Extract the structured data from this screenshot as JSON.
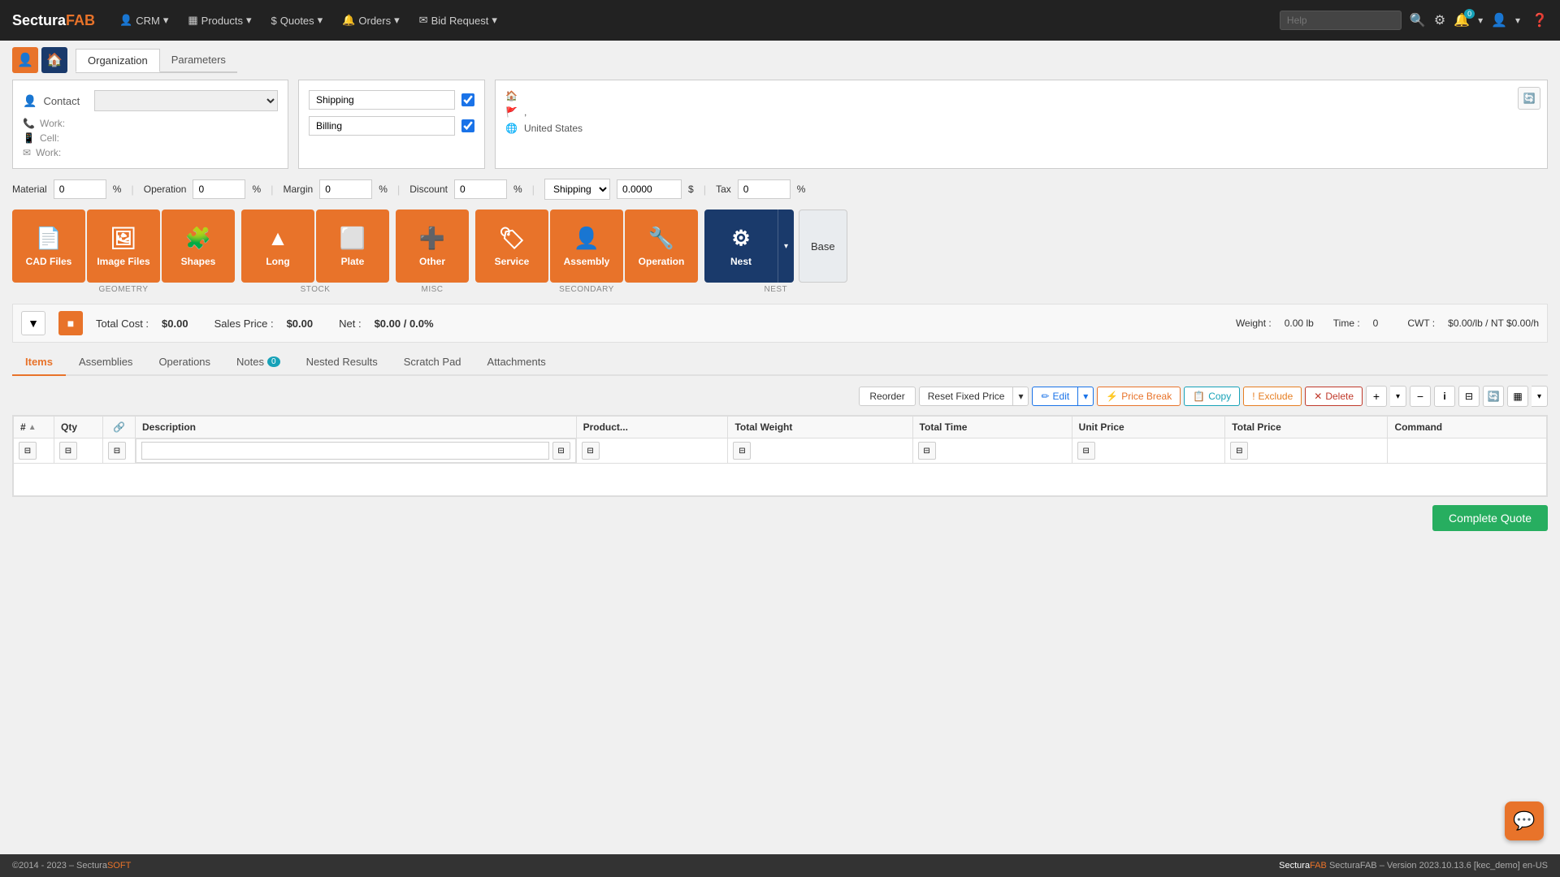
{
  "app": {
    "brand_sectura": "Sectura",
    "brand_fab": "FAB",
    "title": "SecturaFAB"
  },
  "nav": {
    "items": [
      {
        "id": "crm",
        "label": "CRM",
        "icon": "👤",
        "hasDropdown": true
      },
      {
        "id": "products",
        "label": "Products",
        "icon": "▦",
        "hasDropdown": true
      },
      {
        "id": "quotes",
        "label": "Quotes",
        "icon": "$",
        "hasDropdown": true
      },
      {
        "id": "orders",
        "label": "Orders",
        "icon": "🔔",
        "hasDropdown": true
      },
      {
        "id": "bid-request",
        "label": "Bid Request",
        "icon": "✉",
        "hasDropdown": true
      }
    ],
    "help_placeholder": "Help",
    "notifications_count": "0"
  },
  "tabs": {
    "items": [
      {
        "id": "organization",
        "label": "Organization"
      },
      {
        "id": "parameters",
        "label": "Parameters"
      }
    ]
  },
  "contact": {
    "label": "Contact",
    "work_label": "Work:",
    "cell_label": "Cell:",
    "email_label": "Work:"
  },
  "address": {
    "shipping_label": "Shipping",
    "billing_label": "Billing",
    "country": "United States"
  },
  "calc": {
    "material_label": "Material",
    "material_value": "0",
    "material_suffix": "%",
    "operation_label": "Operation",
    "operation_value": "0",
    "operation_suffix": "%",
    "margin_label": "Margin",
    "margin_value": "0",
    "margin_suffix": "%",
    "discount_label": "Discount",
    "discount_value": "0",
    "discount_suffix": "%",
    "shipping_label": "Shipping",
    "shipping_value": "0.0000",
    "shipping_suffix": "$",
    "tax_label": "Tax",
    "tax_value": "0",
    "tax_suffix": "%"
  },
  "buttons": {
    "cad_files": "CAD Files",
    "image_files": "Image Files",
    "shapes": "Shapes",
    "long": "Long",
    "plate": "Plate",
    "other": "Other",
    "service": "Service",
    "assembly": "Assembly",
    "operation": "Operation",
    "nest": "Nest",
    "base": "Base"
  },
  "groups": {
    "geometry": "GEOMETRY",
    "stock": "STOCK",
    "misc": "MISC",
    "secondary": "SECONDARY",
    "nest": "NEST"
  },
  "cost": {
    "total_cost_label": "Total Cost :",
    "total_cost_value": "$0.00",
    "sales_price_label": "Sales Price :",
    "sales_price_value": "$0.00",
    "net_label": "Net :",
    "net_value": "$0.00 / 0.0%",
    "weight_label": "Weight :",
    "weight_value": "0.00 lb",
    "time_label": "Time :",
    "time_value": "0",
    "cwt_label": "CWT :",
    "cwt_value": "$0.00/lb / NT $0.00/h"
  },
  "sub_tabs": {
    "items": [
      {
        "id": "items",
        "label": "Items",
        "active": true
      },
      {
        "id": "assemblies",
        "label": "Assemblies"
      },
      {
        "id": "operations",
        "label": "Operations"
      },
      {
        "id": "notes",
        "label": "Notes",
        "badge": "0"
      },
      {
        "id": "nested-results",
        "label": "Nested Results"
      },
      {
        "id": "scratch-pad",
        "label": "Scratch Pad"
      },
      {
        "id": "attachments",
        "label": "Attachments"
      }
    ]
  },
  "toolbar": {
    "reorder": "Reorder",
    "reset_fixed_price": "Reset Fixed Price",
    "edit": "Edit",
    "price_break": "Price Break",
    "copy": "Copy",
    "exclude": "Exclude",
    "delete": "Delete"
  },
  "table": {
    "columns": [
      {
        "id": "num",
        "label": "#"
      },
      {
        "id": "qty",
        "label": "Qty"
      },
      {
        "id": "link",
        "label": ""
      },
      {
        "id": "description",
        "label": "Description"
      },
      {
        "id": "product",
        "label": "Product..."
      },
      {
        "id": "total_weight",
        "label": "Total Weight"
      },
      {
        "id": "total_time",
        "label": "Total Time"
      },
      {
        "id": "unit_price",
        "label": "Unit Price"
      },
      {
        "id": "total_price",
        "label": "Total Price"
      },
      {
        "id": "command",
        "label": "Command"
      }
    ]
  },
  "complete_quote_btn": "Complete Quote",
  "footer": {
    "copyright": "©2014 - 2023 - Sectura",
    "soft": "SOFT",
    "version_info": "SecturaFAB – Version 2023.10.13.6 [kec_demo] en-US"
  }
}
